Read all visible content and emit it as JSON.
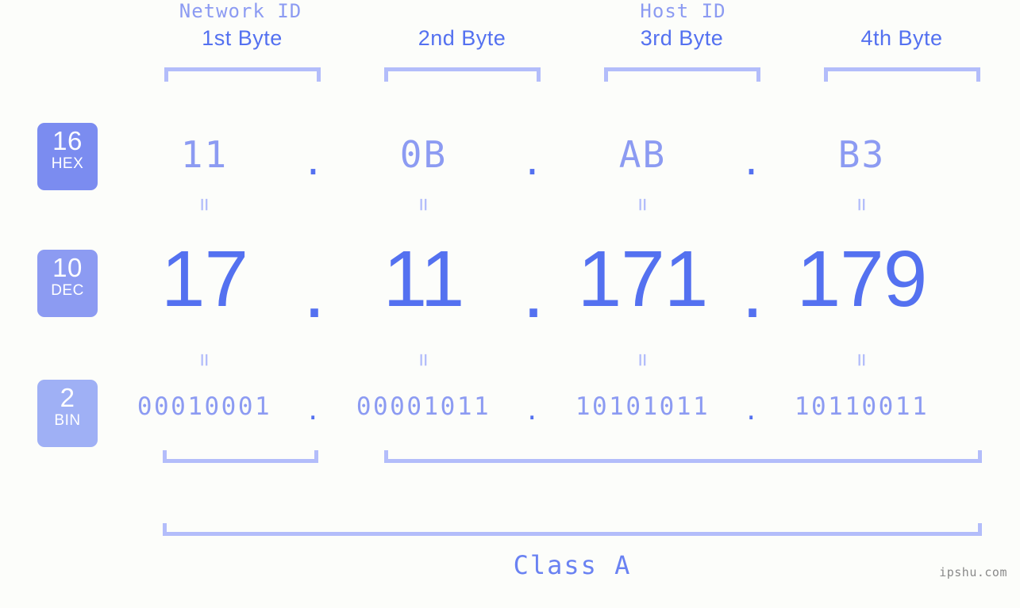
{
  "page": {
    "background_color": "#fcfdfa",
    "accent_color": "#5471f0",
    "accent_light_color": "#8c9bf2",
    "bracket_color": "#b3bdfa"
  },
  "byte_headers": [
    {
      "label": "1st Byte"
    },
    {
      "label": "2nd Byte"
    },
    {
      "label": "3rd Byte"
    },
    {
      "label": "4th Byte"
    }
  ],
  "bases": [
    {
      "number": "16",
      "name": "HEX",
      "color": "#7b8cf0"
    },
    {
      "number": "10",
      "name": "DEC",
      "color": "#8c9bf2"
    },
    {
      "number": "2",
      "name": "BIN",
      "color": "#9fb0f5"
    }
  ],
  "rows": {
    "hex": {
      "base_number": "16",
      "base_name": "HEX",
      "values": [
        "11",
        "0B",
        "AB",
        "B3"
      ],
      "separator": "."
    },
    "dec": {
      "base_number": "10",
      "base_name": "DEC",
      "values": [
        "17",
        "11",
        "171",
        "179"
      ],
      "separator": "."
    },
    "bin": {
      "base_number": "2",
      "base_name": "BIN",
      "values": [
        "00010001",
        "00001011",
        "10101011",
        "10110011"
      ],
      "separator": "."
    }
  },
  "equality_marks": {
    "glyph": "=",
    "count_top": 4,
    "count_bottom": 4
  },
  "sections": {
    "network_id": "Network ID",
    "host_id": "Host ID",
    "class": "Class A"
  },
  "watermark": "ipshu.com"
}
